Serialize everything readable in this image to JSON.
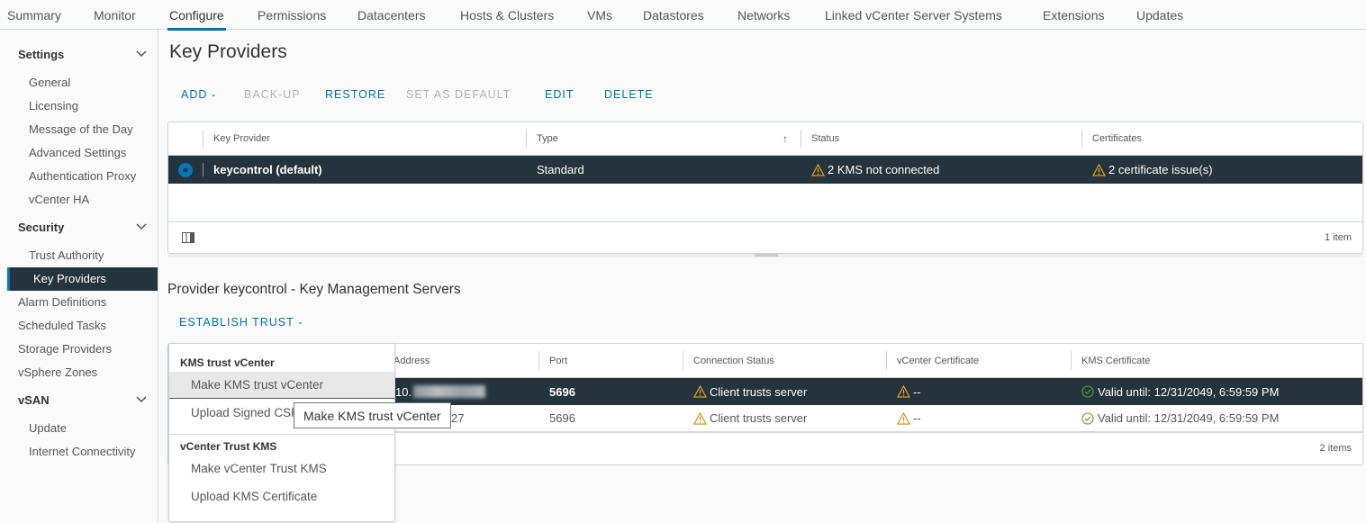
{
  "topnav": {
    "tabs": [
      {
        "label": "Summary"
      },
      {
        "label": "Monitor"
      },
      {
        "label": "Configure",
        "active": true
      },
      {
        "label": "Permissions"
      },
      {
        "label": "Datacenters"
      },
      {
        "label": "Hosts & Clusters"
      },
      {
        "label": "VMs"
      },
      {
        "label": "Datastores"
      },
      {
        "label": "Networks"
      },
      {
        "label": "Linked vCenter Server Systems"
      },
      {
        "label": "Extensions"
      },
      {
        "label": "Updates"
      }
    ]
  },
  "sidebar": {
    "groups": {
      "settings": "Settings",
      "security": "Security",
      "vsan": "vSAN"
    },
    "settings_items": [
      "General",
      "Licensing",
      "Message of the Day",
      "Advanced Settings",
      "Authentication Proxy",
      "vCenter HA"
    ],
    "security_items": [
      "Trust Authority",
      "Key Providers"
    ],
    "flat_items": [
      "Alarm Definitions",
      "Scheduled Tasks",
      "Storage Providers",
      "vSphere Zones"
    ],
    "vsan_items": [
      "Update",
      "Internet Connectivity"
    ],
    "active": "Key Providers"
  },
  "main": {
    "title": "Key Providers",
    "toolbar": {
      "add": "ADD",
      "backup": "BACK-UP",
      "restore": "RESTORE",
      "set_default": "SET AS DEFAULT",
      "edit": "EDIT",
      "delete": "DELETE"
    },
    "providers_grid": {
      "columns": [
        "Key Provider",
        "Type",
        "Status",
        "Certificates"
      ],
      "rows": [
        {
          "name": "keycontrol (default)",
          "type": "Standard",
          "status": "2 KMS not connected",
          "certificates": "2 certificate issue(s)",
          "selected": true
        }
      ],
      "footer_count": "1 item"
    },
    "kms_section": {
      "title": "Provider keycontrol - Key Management Servers",
      "establish_trust": "ESTABLISH TRUST",
      "grid": {
        "columns": [
          "Address",
          "Port",
          "Connection Status",
          "vCenter Certificate",
          "KMS Certificate"
        ],
        "rows": [
          {
            "address": "10.",
            "port": "5696",
            "connection_status": "Client trusts server",
            "vcenter_cert": "--",
            "kms_cert": "Valid until: 12/31/2049, 6:59:59 PM",
            "selected": true
          },
          {
            "address": "27",
            "port": "5696",
            "connection_status": "Client trusts server",
            "vcenter_cert": "--",
            "kms_cert": "Valid until: 12/31/2049, 6:59:59 PM",
            "selected": false
          }
        ],
        "footer_count": "2 items"
      }
    },
    "dropdown": {
      "header1": "KMS trust vCenter",
      "items1": [
        "Make KMS trust vCenter",
        "Upload Signed CSR Certificate"
      ],
      "header2": "vCenter Trust KMS",
      "items2": [
        "Make vCenter Trust KMS",
        "Upload KMS Certificate"
      ],
      "tooltip": "Make KMS trust vCenter"
    }
  },
  "colors": {
    "accent": "#0072a3",
    "selected_row": "#25333d",
    "warning": "#e6a817",
    "success": "#5aa220"
  }
}
